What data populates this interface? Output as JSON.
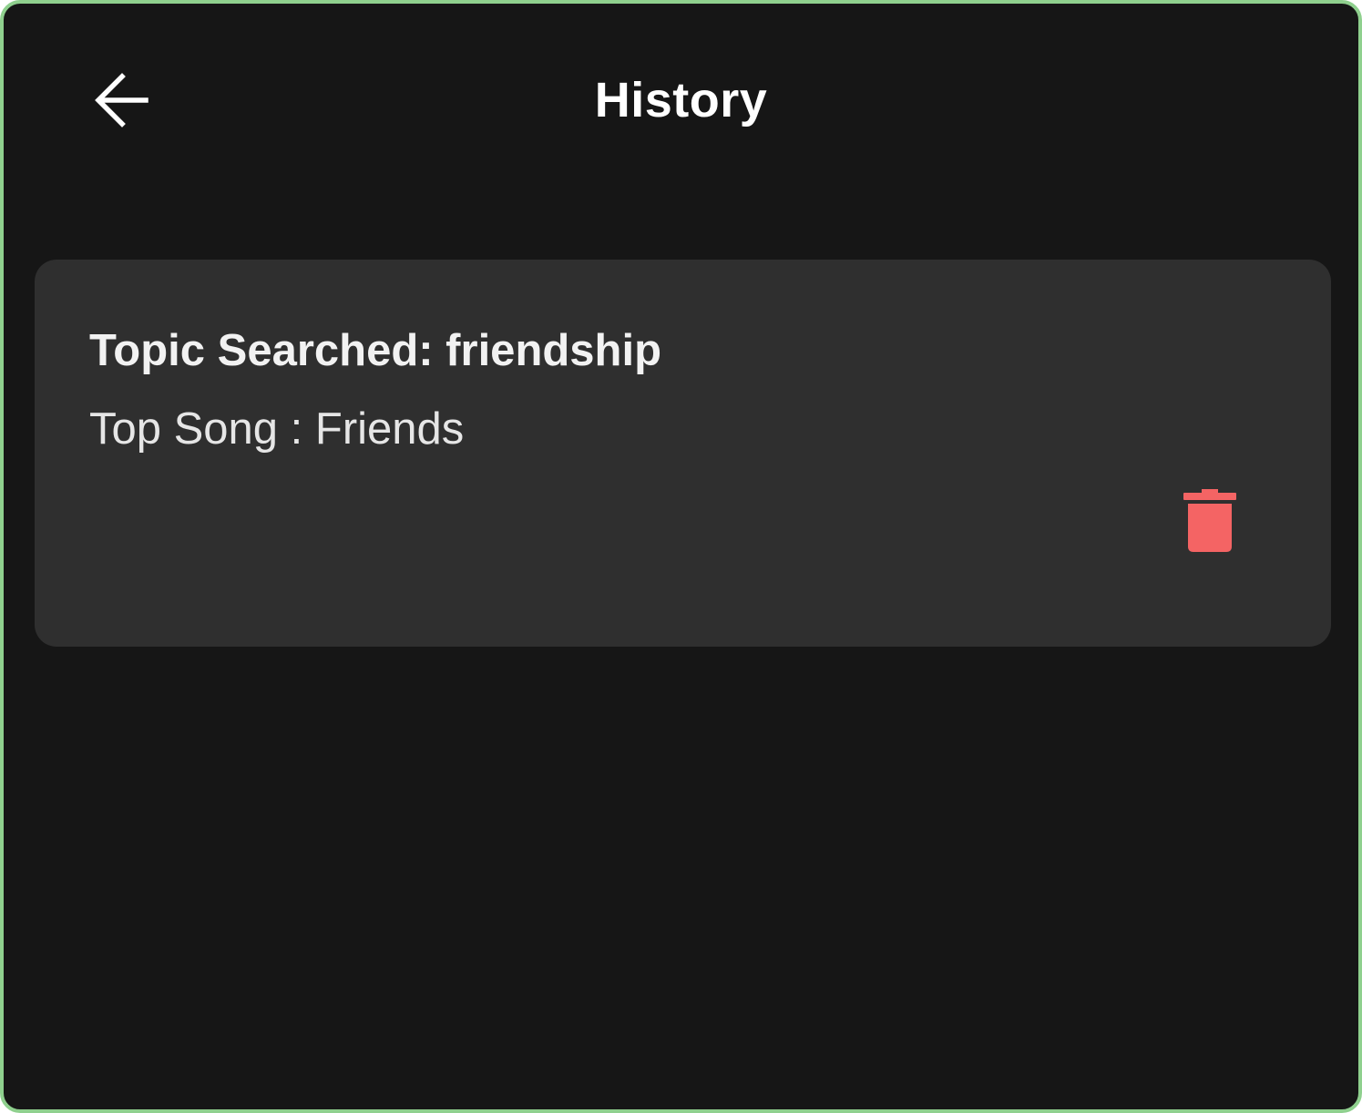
{
  "header": {
    "title": "History",
    "back_icon": "arrow-left-icon"
  },
  "history": {
    "items": [
      {
        "topic_text": "Topic Searched: friendship",
        "song_text": "Top Song : Friends",
        "delete_icon": "trash-icon"
      }
    ]
  },
  "colors": {
    "background": "#161616",
    "card": "#2f2f2f",
    "frame_border": "#8fd08e",
    "delete_accent": "#f46464",
    "text": "#ffffff"
  }
}
